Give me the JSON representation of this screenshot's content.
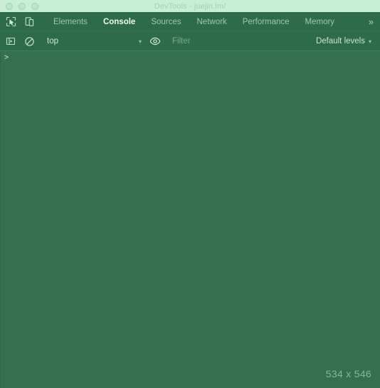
{
  "window": {
    "title": "DevTools - juejin.im/",
    "traffic_lights": [
      "close-button",
      "minimize-button",
      "zoom-button"
    ],
    "titlebar_bg": "#c9edd5",
    "titlebar_text_color": "#9fd0b0"
  },
  "tabbar": {
    "inspect_icon": "inspect-element-icon",
    "device_icon": "device-toolbar-icon",
    "tabs": [
      {
        "label": "Elements",
        "active": false
      },
      {
        "label": "Console",
        "active": true
      },
      {
        "label": "Sources",
        "active": false
      },
      {
        "label": "Network",
        "active": false
      },
      {
        "label": "Performance",
        "active": false
      },
      {
        "label": "Memory",
        "active": false
      }
    ],
    "overflow_label": "»",
    "bg": "#2e6b4a",
    "active_tab_color": "#f2fbf5",
    "inactive_tab_color": "#9cc9ae"
  },
  "console_toolbar": {
    "sidebar_icon": "console-sidebar-icon",
    "clear_icon": "clear-console-icon",
    "context": {
      "value": "top",
      "caret": "▾"
    },
    "eye_icon": "live-expression-eye-icon",
    "filter": {
      "value": "",
      "placeholder": "Filter"
    },
    "levels": {
      "label": "Default levels",
      "caret": "▾"
    }
  },
  "console_body": {
    "prompt": ">",
    "messages": [],
    "bg": "#34704f"
  },
  "size_overlay": {
    "text": "534 x 546",
    "color": "#86b59a"
  }
}
